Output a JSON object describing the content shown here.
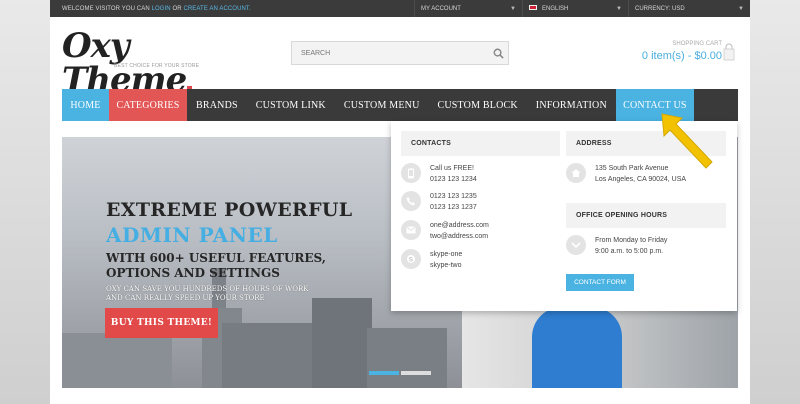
{
  "topbar": {
    "welcome_prefix": "WELCOME VISITOR YOU CAN ",
    "login": "LOGIN",
    "or": " OR ",
    "create_account": "CREATE AN ACCOUNT.",
    "account": "MY ACCOUNT",
    "language": "ENGLISH",
    "currency": "CURRENCY: USD"
  },
  "header": {
    "logo": "Oxy Theme",
    "tagline": "BEST CHOICE FOR YOUR STORE",
    "search_placeholder": "SEARCH",
    "cart_label": "SHOPPING CART",
    "cart_value": "0 item(s) - $0.00"
  },
  "nav": {
    "items": [
      "HOME",
      "CATEGORIES",
      "BRANDS",
      "CUSTOM LINK",
      "CUSTOM MENU",
      "CUSTOM BLOCK",
      "INFORMATION",
      "CONTACT US"
    ]
  },
  "hero": {
    "line1": "EXTREME POWERFUL",
    "line2": "ADMIN PANEL",
    "line3": "WITH 600+ USEFUL FEATURES, OPTIONS AND SETTINGS",
    "paragraph": "OXY CAN SAVE YOU HUNDREDS OF HOURS OF WORK AND CAN REALLY SPEED UP YOUR STORE",
    "button": "BUY THIS THEME!"
  },
  "contact_menu": {
    "contacts_title": "CONTACTS",
    "phone_free_label": "Call us FREE!",
    "phone_free": "0123 123 1234",
    "phone1": "0123 123 1235",
    "phone2": "0123 123 1237",
    "email1": "one@address.com",
    "email2": "two@address.com",
    "skype1": "skype-one",
    "skype2": "skype-two",
    "address_title": "ADDRESS",
    "address_line1": "135 South Park Avenue",
    "address_line2": "Los Angeles, CA 90024, USA",
    "hours_title": "OFFICE OPENING HOURS",
    "hours_line1": "From Monday to Friday",
    "hours_line2": "9:00 a.m. to 5:00 p.m.",
    "contact_button": "CONTACT FORM"
  },
  "colors": {
    "accent_blue": "#4ab3e2",
    "accent_red": "#e35656",
    "nav_dark": "#3a3a3a",
    "pointer_arrow": "#f2c200"
  }
}
